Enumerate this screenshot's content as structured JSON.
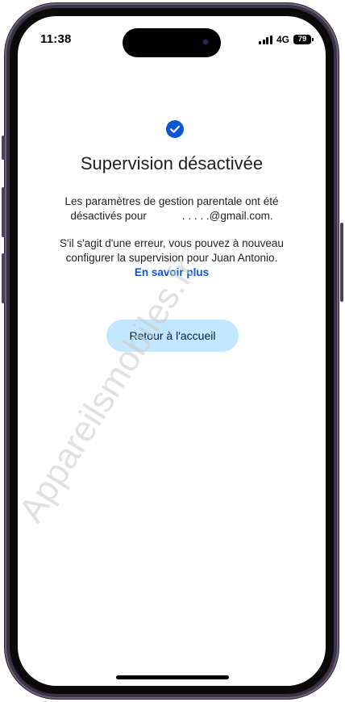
{
  "status_bar": {
    "time": "11:38",
    "network": "4G",
    "battery": "79"
  },
  "content": {
    "title": "Supervision désactivée",
    "para1_line1": "Les paramètres de gestion parentale ont été",
    "para1_line2_prefix": "désactivés pour",
    "para1_line2_email": ". . . . .@gmail.com.",
    "para2_line1": "S'il s'agit d'une erreur, vous pouvez à nouveau",
    "para2_line2": "configurer la supervision pour Juan Antonio.",
    "learn_more_link": "En savoir plus",
    "home_button": "Retour à l'accueil"
  },
  "watermark": "Appareilsmobiles.fr",
  "colors": {
    "accent": "#0b57d0",
    "button_bg": "#c2e7ff",
    "phone_frame": "#3a3345"
  },
  "icons": {
    "check": "check-circle-icon"
  }
}
